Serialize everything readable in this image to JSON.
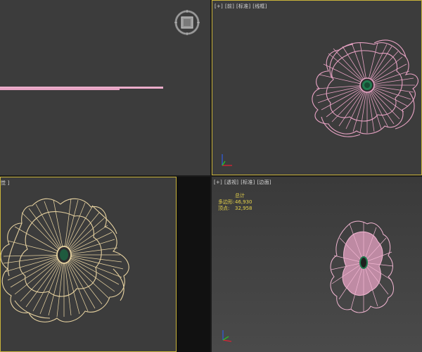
{
  "viewports": {
    "top_left": {
      "label": ""
    },
    "top_right": {
      "labels": [
        "[+]",
        "[前]",
        "[标准]",
        "[线框]"
      ]
    },
    "bottom_left": {
      "label": "觉 ]"
    },
    "bottom_right": {
      "labels": [
        "[+]",
        "[透视]",
        "[标准]",
        "[边面]"
      ],
      "stats": {
        "title": "总计",
        "polygons_label": "多边形:",
        "polygons_value": "46,930",
        "vertices_label": "顶点:",
        "vertices_value": "32,958"
      }
    }
  },
  "icons": [
    "viewcube-icon",
    "axis-gizmo-icon"
  ],
  "colors": {
    "viewport_bg": "#3c3c3c",
    "active_border": "#c9b33a",
    "mesh_pink": "#e8a3c4",
    "mesh_wire_gold": "#e7d2a0",
    "stats_yellow": "#e8d44a",
    "center_green": "#1f7a4e"
  }
}
